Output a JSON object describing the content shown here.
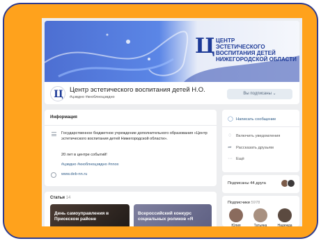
{
  "cover": {
    "logo_letter": "Ц",
    "org_lines": [
      "ЦЕНТР",
      "ЭСТЕТИЧЕСКОГО",
      "ВОСПИТАНИЯ ДЕТЕЙ",
      "НИЖЕГОРОДСКОЙ ОБЛАСТИ"
    ]
  },
  "community": {
    "name": "Центр эстетического воспитания детей Н.О.",
    "tags": "#цэвдно #кноблноцэвдно",
    "subscribe_label": "Вы подписаны ⌄"
  },
  "info": {
    "title": "Информация",
    "description": "Государственное бюджетное учреждение дополнительного образования «Центр эстетического воспитания детей Нижегородской области».",
    "tagline": "20 лет в центре событий!",
    "hashtags": "#цэвдно #кноблноцэвдно #nnox",
    "url": "www.deb-nn.ru"
  },
  "actions": {
    "write_message": "Написать сообщение",
    "enable_notifications": "Включить уведомления",
    "tell_friends": "Рассказать друзьям",
    "more": "Ещё"
  },
  "friends": {
    "label": "Подписаны 44 друга"
  },
  "subscribers": {
    "title": "Подписчики",
    "count": "5978",
    "people": [
      {
        "name": "Юлия"
      },
      {
        "name": "Татьяна"
      },
      {
        "name": "Надежда"
      }
    ]
  },
  "articles": {
    "title": "Статьи",
    "count": "14",
    "items": [
      {
        "title": "День самоуправления в Приокском районе"
      },
      {
        "title": "Всероссийский конкурс социальных роликов «Я"
      }
    ]
  },
  "icons": {
    "message": "message-icon",
    "bell": "bell-icon",
    "share": "share-icon",
    "more": "more-icon",
    "globe": "globe-icon",
    "info": "info-icon"
  },
  "colors": {
    "frame_orange": "#ffa21c",
    "frame_border": "#2d3b8f",
    "vk_link": "#2a5885",
    "brand_blue": "#1d3a97"
  }
}
